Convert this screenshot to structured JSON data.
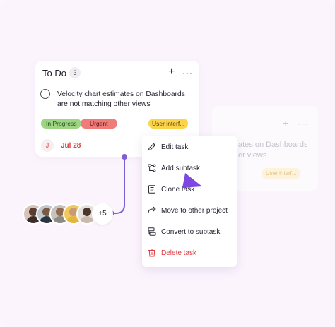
{
  "column": {
    "title": "To Do",
    "count": "3",
    "add_label": "+",
    "more_label": "···"
  },
  "task": {
    "title": "Velocity chart estimates on Dashboards are not matching other views",
    "tags": [
      {
        "label": "In Progress",
        "color": "#9ed583"
      },
      {
        "label": "Urgent",
        "color": "#f07b78"
      },
      {
        "label": "User interf...",
        "color": "#fbd44a"
      }
    ],
    "assignee_initial": "J",
    "due_date": "Jul 28"
  },
  "ghost": {
    "plus": "+",
    "more": "···",
    "text": "ates on Dashboards er views",
    "tag": "User interf..."
  },
  "avatars": {
    "extra_count": "+5"
  },
  "context_menu": {
    "items": [
      {
        "label": "Edit task",
        "icon": "pencil-icon"
      },
      {
        "label": "Add subtask",
        "icon": "subtask-icon"
      },
      {
        "label": "Clone task",
        "icon": "clone-icon"
      },
      {
        "label": "Move to other project",
        "icon": "move-arrow-icon"
      },
      {
        "label": "Convert to subtask",
        "icon": "convert-icon"
      },
      {
        "label": "Delete task",
        "icon": "trash-icon"
      }
    ]
  },
  "colors": {
    "accent": "#7c5fd6",
    "danger": "#e0393f",
    "background": "#fbf5fd"
  }
}
